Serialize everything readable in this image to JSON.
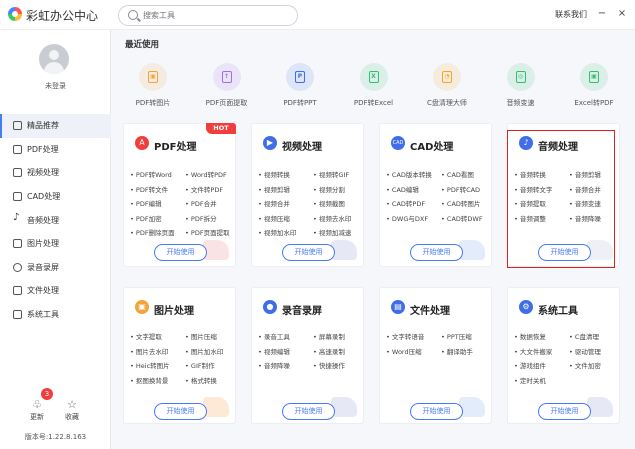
{
  "app": {
    "title": "彩虹办公中心",
    "contact": "联系我们",
    "min_label": "−",
    "close_label": "×"
  },
  "search": {
    "placeholder": "搜索工具"
  },
  "user": {
    "name": "未登录"
  },
  "sidebar": {
    "items": [
      {
        "label": "精品推荐",
        "active": true
      },
      {
        "label": "PDF处理"
      },
      {
        "label": "视频处理"
      },
      {
        "label": "CAD处理"
      },
      {
        "label": "音频处理"
      },
      {
        "label": "图片处理"
      },
      {
        "label": "录音录屏"
      },
      {
        "label": "文件处理"
      },
      {
        "label": "系统工具"
      }
    ],
    "update_label": "更新",
    "update_badge": "3",
    "fav_label": "收藏",
    "version": "版本号:1.22.8.163"
  },
  "recent": {
    "title": "最近使用",
    "items": [
      {
        "label": "PDF转图片",
        "color": "#f2a33a"
      },
      {
        "label": "PDF页面提取",
        "color": "#a26bf0"
      },
      {
        "label": "PDF转PPT",
        "color": "#3f6ee8"
      },
      {
        "label": "PDF转Excel",
        "color": "#2fbf71"
      },
      {
        "label": "C盘清理大师",
        "color": "#f5a623"
      },
      {
        "label": "音频变速",
        "color": "#2fbf71"
      },
      {
        "label": "Excel转PDF",
        "color": "#2fbf71"
      }
    ]
  },
  "cards": [
    {
      "title": "PDF处理",
      "hot": "HOT",
      "start": "开始使用",
      "deco": "#fbe3e3",
      "features": [
        "PDF转Word",
        "Word转PDF",
        "PDF转文件",
        "文件转PDF",
        "PDF编辑",
        "PDF合并",
        "PDF加密",
        "PDF拆分",
        "PDF删除页面",
        "PDF页面提取"
      ]
    },
    {
      "title": "视频处理",
      "start": "开始使用",
      "deco": "#e6e9f5",
      "features": [
        "视频转换",
        "视频转GIF",
        "视频剪辑",
        "视频分割",
        "视频合并",
        "视频截图",
        "视频压缩",
        "视频去水印",
        "视频加水印",
        "视频加减速"
      ]
    },
    {
      "title": "CAD处理",
      "start": "开始使用",
      "deco": "#e3ecfb",
      "features": [
        "CAD版本转换",
        "CAD看图",
        "CAD编辑",
        "PDF转CAD",
        "CAD转PDF",
        "CAD转图片",
        "DWG与DXF",
        "CAD转DWF"
      ]
    },
    {
      "title": "音频处理",
      "start": "开始使用",
      "deco": "#eef0f6",
      "features": [
        "音频转换",
        "音频剪辑",
        "音频转文字",
        "音频合并",
        "音频提取",
        "音频变速",
        "音频调整",
        "音频降噪"
      ]
    },
    {
      "title": "图片处理",
      "start": "开始使用",
      "deco": "#fde9d6",
      "features": [
        "文字提取",
        "图片压缩",
        "图片去水印",
        "图片加水印",
        "Heic转图片",
        "GIF制作",
        "抠图换背景",
        "格式转换"
      ]
    },
    {
      "title": "录音录屏",
      "start": "开始使用",
      "deco": "#e6e9f5",
      "features": [
        "录音工具",
        "屏幕录制",
        "视频编辑",
        "高速录制",
        "音频降噪",
        "快捷操作"
      ]
    },
    {
      "title": "文件处理",
      "start": "开始使用",
      "deco": "#e3ecfb",
      "features": [
        "文字转语音",
        "PPT压缩",
        "Word压缩",
        "翻译助手"
      ]
    },
    {
      "title": "系统工具",
      "start": "开始使用",
      "deco": "#e6e9f5",
      "features": [
        "数据恢复",
        "C盘清理",
        "大文件搬家",
        "驱动管理",
        "游戏组件",
        "文件加密",
        "定时关机"
      ]
    }
  ]
}
